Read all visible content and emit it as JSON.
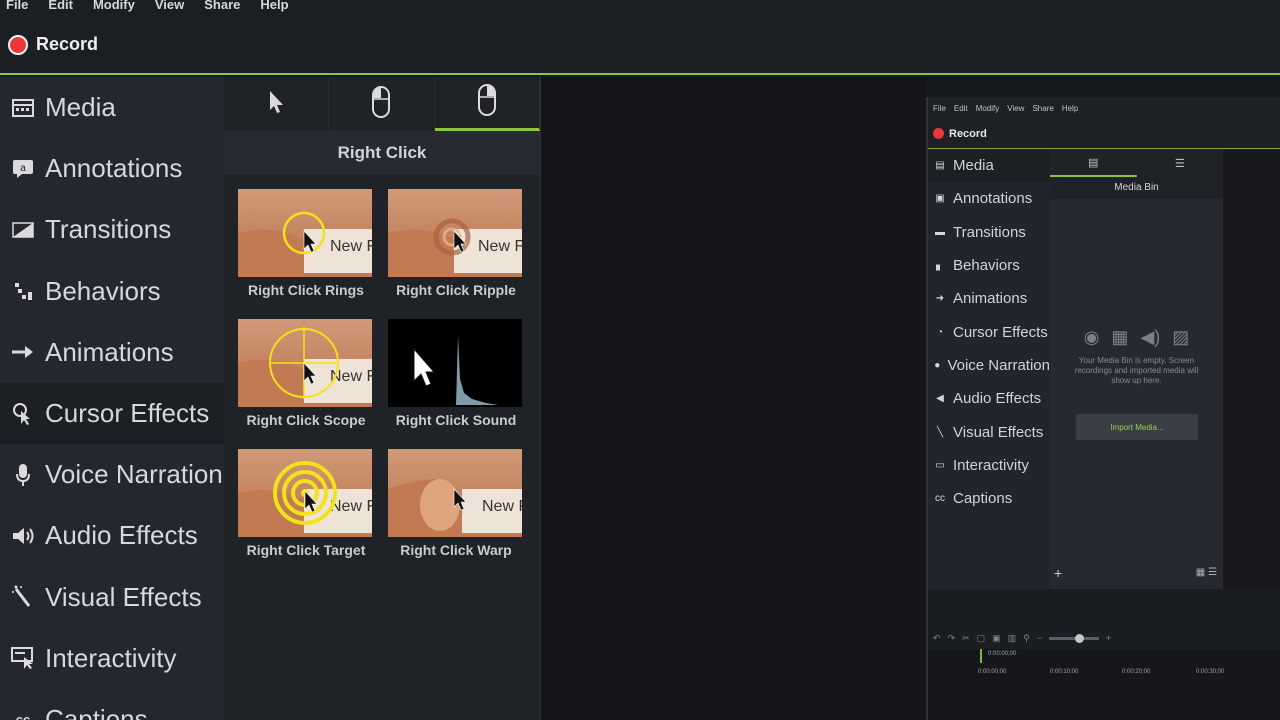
{
  "menu": [
    "File",
    "Edit",
    "Modify",
    "View",
    "Share",
    "Help"
  ],
  "record_label": "Record",
  "sidebar": {
    "items": [
      {
        "label": "Media",
        "icon": "media-icon"
      },
      {
        "label": "Annotations",
        "icon": "annotations-icon"
      },
      {
        "label": "Transitions",
        "icon": "transitions-icon"
      },
      {
        "label": "Behaviors",
        "icon": "behaviors-icon"
      },
      {
        "label": "Animations",
        "icon": "animations-icon"
      },
      {
        "label": "Cursor Effects",
        "icon": "cursor-effects-icon",
        "active": true
      },
      {
        "label": "Voice Narration",
        "icon": "microphone-icon"
      },
      {
        "label": "Audio Effects",
        "icon": "speaker-icon"
      },
      {
        "label": "Visual Effects",
        "icon": "wand-icon"
      },
      {
        "label": "Interactivity",
        "icon": "interactivity-icon"
      },
      {
        "label": "Captions",
        "icon": "captions-icon"
      }
    ]
  },
  "panel": {
    "tabs": [
      {
        "name": "cursor-tab",
        "icon": "pointer-icon"
      },
      {
        "name": "left-click-tab",
        "icon": "mouse-left-icon"
      },
      {
        "name": "right-click-tab",
        "icon": "mouse-right-icon",
        "active": true
      }
    ],
    "section_title": "Right Click",
    "tiles": [
      {
        "label": "Right Click Rings"
      },
      {
        "label": "Right Click Ripple"
      },
      {
        "label": "Right Click Scope"
      },
      {
        "label": "Right Click Sound"
      },
      {
        "label": "Right Click Target"
      },
      {
        "label": "Right Click Warp"
      }
    ],
    "thumb_text": "New F"
  },
  "mini": {
    "menu": [
      "File",
      "Edit",
      "Modify",
      "View",
      "Share",
      "Help"
    ],
    "record_label": "Record",
    "sidebar": [
      "Media",
      "Annotations",
      "Transitions",
      "Behaviors",
      "Animations",
      "Cursor Effects",
      "Voice Narration",
      "Audio Effects",
      "Visual Effects",
      "Interactivity",
      "Captions"
    ],
    "bin_title": "Media Bin",
    "empty_message": "Your Media Bin is empty. Screen recordings and imported media will show up here.",
    "import_button": "Import Media...",
    "playhead_time": "0:00:00;00",
    "ruler": [
      "0:00:00;00",
      "0:00:10;00",
      "0:00:20;00",
      "0:00:30;00"
    ]
  },
  "colors": {
    "accent": "#8cc63f",
    "record": "#e8393a",
    "ring": "#f2e21c"
  }
}
